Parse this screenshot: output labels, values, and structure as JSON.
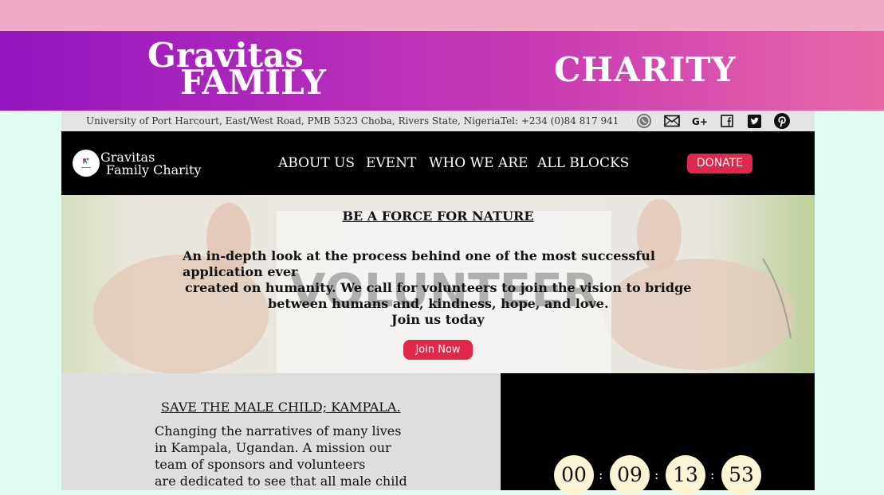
{
  "brand": {
    "line1": "Gravitas",
    "line2": "FAMILY",
    "line3": "CHARITY"
  },
  "info": {
    "address": "University of Port Harcourt, East/West Road, PMB 5323 Choba, Rivers State, Nigeria.",
    "tel": "Tel: +234 (0)84 817 941",
    "social_icons": [
      "whatsapp-icon",
      "mail-icon",
      "google-plus-icon",
      "facebook-icon",
      "twitter-icon",
      "pinterest-icon"
    ]
  },
  "nav": {
    "logo_line1": "Gravitas",
    "logo_line2": "Family Charity",
    "items": [
      "ABOUT US",
      "EVENT",
      "WHO WE ARE",
      "ALL BLOCKS"
    ],
    "donate": "DONATE"
  },
  "hero": {
    "title": "BE A FORCE FOR NATURE",
    "lines": [
      "An in-depth look at the process behind one of the most successful",
      "application ever",
      "created on humanity. We call for volunteers to join the vision to bridge",
      "between humans and, kindness, hope, and love.",
      "Join us today"
    ],
    "shirt_text": "VOLUNTEER",
    "button": "Join Now"
  },
  "feature": {
    "title": "SAVE THE MALE CHILD; KAMPALA.",
    "lines": [
      "Changing the narratives of many lives",
      "in Kampala, Ugandan. A mission our",
      "team of sponsors and volunteers",
      "are dedicated to see that all male child"
    ]
  },
  "countdown": {
    "values": [
      "00",
      "09",
      "13",
      "53"
    ],
    "separator": ":"
  },
  "colors": {
    "topbar": "#f1a9c8",
    "brand_gradient_start": "#9216be",
    "brand_gradient_end": "#e868a6",
    "accent_red": "#e0294a",
    "page_bg": "#e2fbf3"
  }
}
